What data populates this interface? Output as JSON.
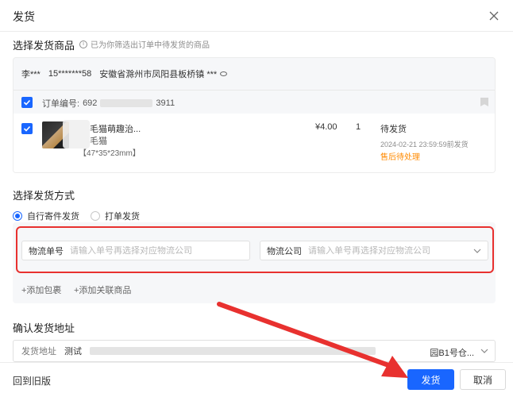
{
  "dialog": {
    "title": "发货"
  },
  "goods_section": {
    "title": "选择发货商品",
    "hint": "已为你筛选出订单中待发货的商品",
    "buyer_name": "李***",
    "buyer_phone": "15*******58",
    "buyer_address": "安徽省滁州市凤阳县板桥镇 ***",
    "order_label": "订单编号:",
    "order_prefix": "692",
    "order_suffix": "3911",
    "item": {
      "title": "毛猫萌趣治...",
      "spec1": "毛猫",
      "spec2": "【47*35*23mm】",
      "price": "¥4.00",
      "quantity": "1",
      "status": "待发货",
      "deadline": "2024-02-21 23:59:59前发货",
      "after_sale": "售后待处理"
    }
  },
  "method_section": {
    "title": "选择发货方式",
    "options": [
      "自行寄件发货",
      "打单发货"
    ],
    "selected_index": 0,
    "tracking_label": "物流单号",
    "tracking_placeholder": "请输入单号再选择对应物流公司",
    "company_label": "物流公司",
    "company_placeholder": "请输入单号再选择对应物流公司",
    "add_package": "+添加包裹",
    "add_related": "+添加关联商品"
  },
  "address_section": {
    "title": "确认发货地址",
    "label": "发货地址",
    "value": "测试",
    "tail": "园B1号仓..."
  },
  "footer": {
    "back_label": "回到旧版",
    "ship_button": "发货",
    "cancel_button": "取消"
  },
  "colors": {
    "primary": "#1966ff",
    "highlight_border": "#e8312f",
    "warning_text": "#ff8a00",
    "annotation_arrow": "#e8312f"
  },
  "icons": [
    "close-icon",
    "info-icon",
    "eye-icon",
    "flag-icon",
    "checkbox-checked-icon",
    "chevron-down-icon",
    "annotation-arrow"
  ]
}
